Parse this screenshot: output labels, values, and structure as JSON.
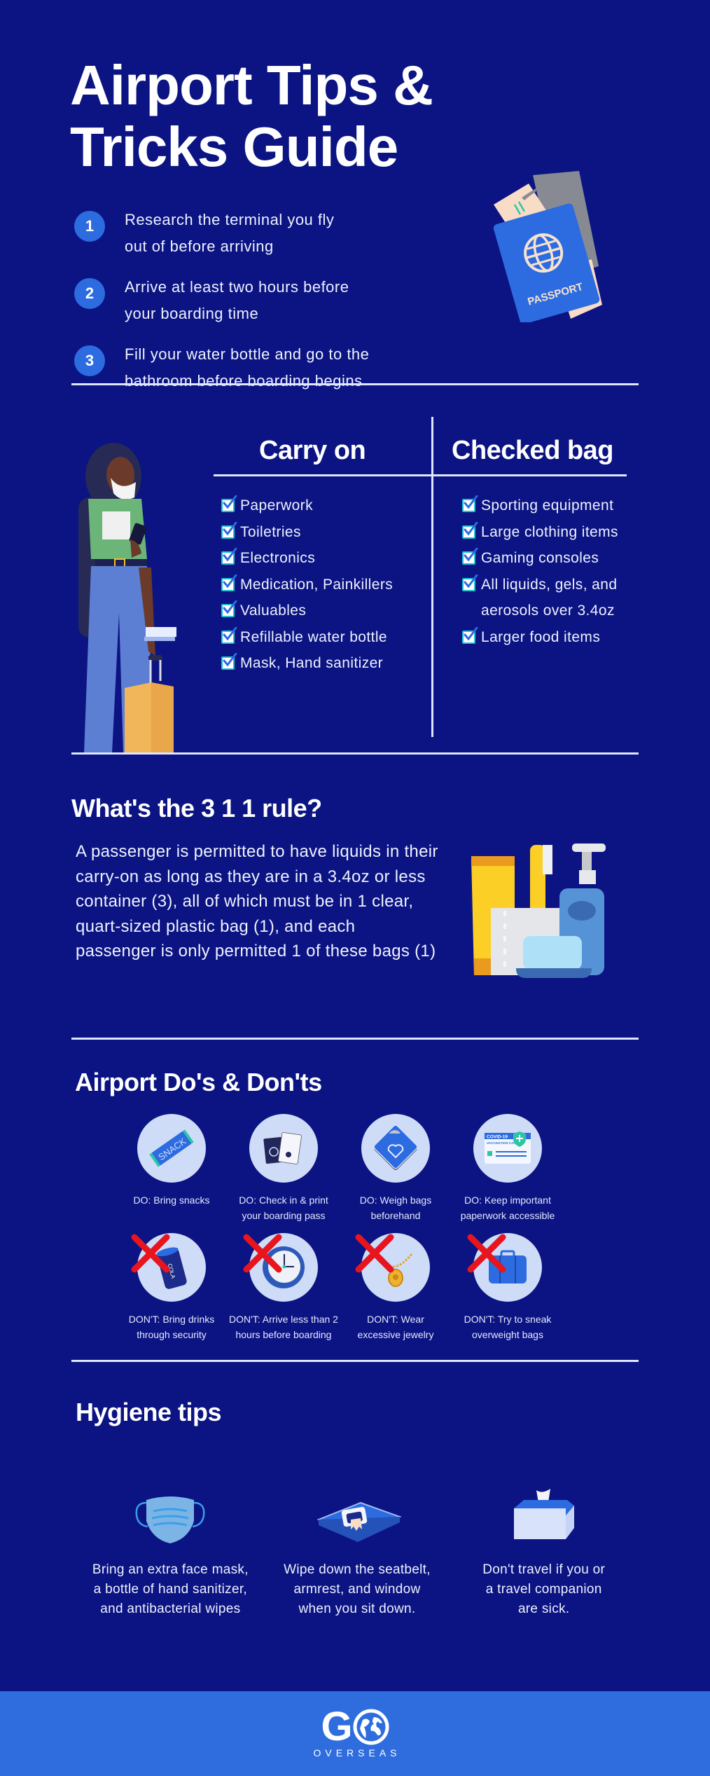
{
  "title": {
    "line1": "Airport Tips &",
    "line2": "Tricks Guide"
  },
  "tips": [
    {
      "num": "1",
      "text": "Research the terminal you fly\nout of before arriving"
    },
    {
      "num": "2",
      "text": "Arrive at least two hours before\nyour boarding time"
    },
    {
      "num": "3",
      "text": "Fill your water bottle and go to the\nbathroom before boarding begins"
    }
  ],
  "passport_label": "PASSPORT",
  "bags": {
    "carry_on": {
      "heading": "Carry on",
      "items": [
        "Paperwork",
        "Toiletries",
        "Electronics",
        "Medication, Painkillers",
        "Valuables",
        "Refillable water bottle",
        "Mask, Hand sanitizer"
      ]
    },
    "checked": {
      "heading": "Checked bag",
      "items": [
        "Sporting equipment",
        "Large clothing items",
        "Gaming consoles",
        "All liquids, gels, and aerosols over 3.4oz",
        "Larger food items"
      ]
    }
  },
  "rule_311": {
    "heading": "What's the 3 1 1 rule?",
    "body": "A passenger is permitted to have liquids in their carry-on as long as they are in a 3.4oz or less container (3), all of which must be in 1 clear, quart-sized plastic bag (1), and each passenger is only permitted 1 of these bags (1)"
  },
  "dos_donts": {
    "heading": "Airport Do's & Don'ts",
    "dos": [
      {
        "icon": "snack-icon",
        "label": "DO: Bring snacks"
      },
      {
        "icon": "passport-boarding-pass-icon",
        "label": "DO: Check in & print\nyour boarding pass"
      },
      {
        "icon": "scale-icon",
        "label": "DO: Weigh bags\nbeforehand"
      },
      {
        "icon": "vaccination-card-icon",
        "label": "DO: Keep important\npaperwork accessible"
      }
    ],
    "donts": [
      {
        "icon": "cola-can-icon",
        "label": "DON'T: Bring drinks\nthrough security"
      },
      {
        "icon": "clock-icon",
        "label": "DON'T: Arrive less than 2\nhours before boarding"
      },
      {
        "icon": "necklace-icon",
        "label": "DON'T: Wear\nexcessive jewelry"
      },
      {
        "icon": "suitcase-icon",
        "label": "DON'T: Try to sneak\noverweight bags"
      }
    ],
    "snack_text": "SNACK",
    "cola_text": "COLA",
    "vax_title": "COVID-19",
    "vax_sub": "VACCINATION CARD"
  },
  "hygiene": {
    "heading": "Hygiene tips",
    "items": [
      {
        "icon": "face-mask-icon",
        "text": "Bring an extra face mask,\na bottle of hand sanitizer,\nand antibacterial wipes"
      },
      {
        "icon": "wipes-pack-icon",
        "text": "Wipe down the seatbelt,\narmrest, and window\nwhen you sit down."
      },
      {
        "icon": "tissue-box-icon",
        "text": "Don't travel if you or\na travel companion\nare sick."
      }
    ]
  },
  "footer": {
    "logo_go": "G",
    "logo_sub": "OVERSEAS"
  },
  "colors": {
    "background": "#0b1482",
    "accent": "#2d6be0",
    "footer": "#2f6ddf",
    "divider": "#dfe6ff",
    "icon_circle": "#cfdcf7",
    "dont_x": "#e8141e",
    "check_border": "#1ec2d2"
  }
}
